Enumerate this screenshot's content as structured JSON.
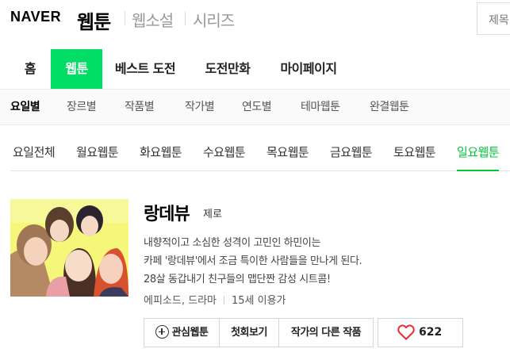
{
  "header": {
    "logo": "NAVER",
    "service": "웹툰",
    "links": [
      "웹소설",
      "시리즈"
    ],
    "search_placeholder": "제목"
  },
  "main_nav": [
    {
      "label": "홈",
      "active": false
    },
    {
      "label": "웹툰",
      "active": true
    },
    {
      "label": "베스트 도전",
      "active": false
    },
    {
      "label": "도전만화",
      "active": false
    },
    {
      "label": "마이페이지",
      "active": false
    }
  ],
  "sub_nav": [
    {
      "label": "요일별",
      "active": true
    },
    {
      "label": "장르별",
      "active": false
    },
    {
      "label": "작품별",
      "active": false
    },
    {
      "label": "작가별",
      "active": false
    },
    {
      "label": "연도별",
      "active": false
    },
    {
      "label": "테마웹툰",
      "active": false
    },
    {
      "label": "완결웹툰",
      "active": false
    }
  ],
  "day_tabs": [
    {
      "label": "요일전체",
      "active": false
    },
    {
      "label": "월요웹툰",
      "active": false
    },
    {
      "label": "화요웹툰",
      "active": false
    },
    {
      "label": "수요웹툰",
      "active": false
    },
    {
      "label": "목요웹툰",
      "active": false
    },
    {
      "label": "금요웹툰",
      "active": false
    },
    {
      "label": "토요웹툰",
      "active": false
    },
    {
      "label": "일요웹툰",
      "active": true
    }
  ],
  "webtoon": {
    "title": "랑데뷰",
    "author": "제로",
    "description": [
      "내향적이고 소심한 성격이 고민인 하민이는",
      "카페 '랑데뷰'에서 조금 특이한 사람들을 만나게 된다.",
      "28살 동갑내기 친구들의 맵단짠 감성 시트콤!"
    ],
    "genre": "에피소드, 드라마",
    "age_rating": "15세 이용가",
    "buttons": {
      "favorite": "관심웹툰",
      "first_episode": "첫회보기",
      "other_works": "작가의 다른 작품"
    },
    "likes": "622"
  },
  "colors": {
    "brand_green": "#00dc64",
    "active_tab_green": "#00c73c",
    "heart_red": "#e82c2c"
  }
}
